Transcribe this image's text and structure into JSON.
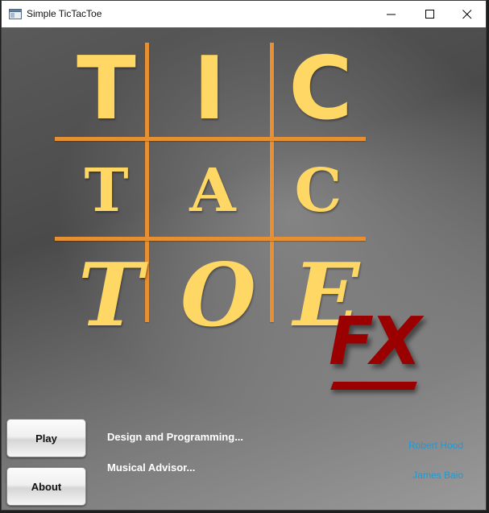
{
  "window": {
    "title": "Simple TicTacToe",
    "controls": [
      "minimize-icon",
      "maximize-icon",
      "close-icon"
    ]
  },
  "logo": {
    "rows": [
      [
        "T",
        "I",
        "C"
      ],
      [
        "T",
        "A",
        "C"
      ],
      [
        "T",
        "O",
        "E"
      ]
    ],
    "badge": "FX",
    "letter_color": "#ffd765",
    "grid_color": "#e78f33",
    "badge_color": "#9b0000"
  },
  "menu": {
    "play_label": "Play",
    "about_label": "About"
  },
  "credits": [
    {
      "role": "Design and Programming...",
      "name": "Robert Hood"
    },
    {
      "role": "Musical Advisor...",
      "name": "James Baio"
    }
  ],
  "colors": {
    "name_link": "#1e9ad6",
    "label_text": "#ffffff"
  }
}
